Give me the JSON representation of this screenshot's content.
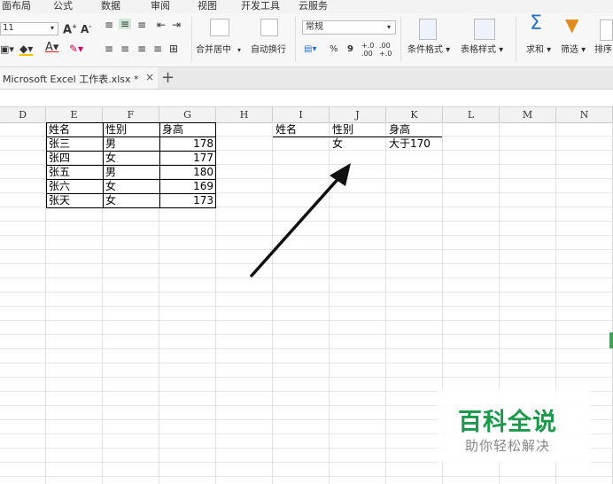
{
  "menu": [
    "面布局",
    "公式",
    "数据",
    "审阅",
    "视图",
    "开发工具",
    "云服务"
  ],
  "ribbon": {
    "font_size": "11",
    "merge_center": "合并居中",
    "wrap_text": "自动换行",
    "number_format": "常规",
    "percent": "%",
    "comma": "9",
    "conditional_format": "条件格式",
    "table_style": "表格样式",
    "sum": "求和",
    "filter": "筛选",
    "sort": "排序"
  },
  "tab": {
    "label": "Microsoft Excel 工作表.xlsx *",
    "close": "×",
    "add": "+"
  },
  "columns": [
    "D",
    "E",
    "F",
    "G",
    "H",
    "I",
    "J",
    "K",
    "L",
    "M",
    "N"
  ],
  "table1": {
    "headers": [
      "姓名",
      "性别",
      "身高"
    ],
    "rows": [
      [
        "张三",
        "男",
        "178"
      ],
      [
        "张四",
        "女",
        "177"
      ],
      [
        "张五",
        "男",
        "180"
      ],
      [
        "张六",
        "女",
        "169"
      ],
      [
        "张天",
        "女",
        "173"
      ]
    ]
  },
  "criteria": {
    "headers": [
      "姓名",
      "性别",
      "身高"
    ],
    "values": [
      "",
      "女",
      "大于170"
    ]
  },
  "watermark": {
    "title": "百科全说",
    "subtitle": "助你轻松解决",
    "color": "#1a9a4a"
  }
}
